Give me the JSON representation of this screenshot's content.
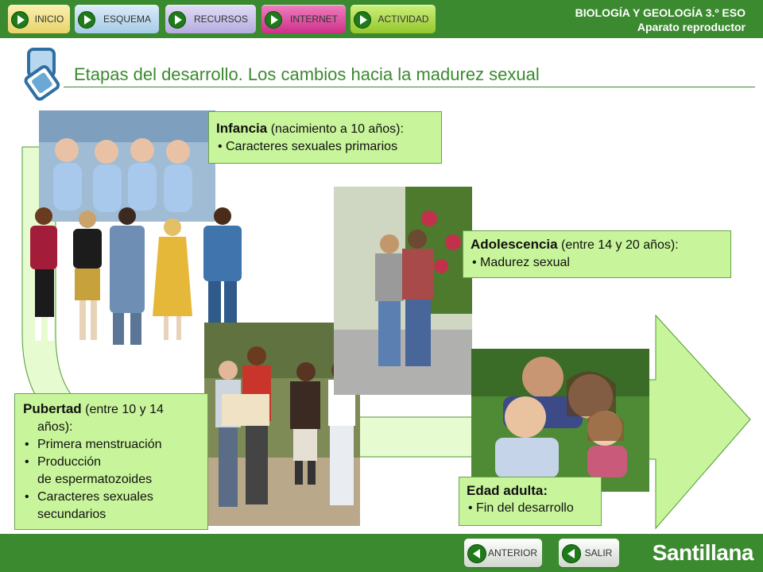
{
  "nav": {
    "items": [
      {
        "label": "INICIO"
      },
      {
        "label": "ESQUEMA"
      },
      {
        "label": "RECURSOS"
      },
      {
        "label": "INTERNET"
      },
      {
        "label": "ACTIVIDAD"
      }
    ]
  },
  "header": {
    "subject": "BIOLOGÍA Y GEOLOGÍA 3.º ESO",
    "unit": "Aparato reproductor"
  },
  "page": {
    "title": "Etapas del desarrollo. Los cambios hacia la madurez sexual"
  },
  "stages": {
    "infancia": {
      "name": "Infancia",
      "range": " (nacimiento a 10 años):",
      "items": [
        "Caracteres sexuales primarios"
      ]
    },
    "pubertad": {
      "name": "Pubertad",
      "range": " (entre 10 y 14",
      "range_cont": "años):",
      "items": [
        "Primera menstruación",
        "Producción",
        "de espermatozoides",
        "Caracteres sexuales",
        "secundarios"
      ]
    },
    "adolescencia": {
      "name": "Adolescencia",
      "range": " (entre 14 y 20 años):",
      "items": [
        "Madurez sexual"
      ]
    },
    "adulta": {
      "name": "Edad adulta:",
      "items": [
        "Fin del desarrollo"
      ]
    }
  },
  "footer": {
    "prev_label": "ANTERIOR",
    "exit_label": "SALIR",
    "logo": "Santillana"
  },
  "colors": {
    "bar_green": "#3b8a2f",
    "light_green": "#c8f59b",
    "nav_inicio": "#f3e189",
    "nav_esquema": "#b9d8ee",
    "nav_recursos": "#c9c3ea",
    "nav_internet": "#d9479a",
    "nav_actividad": "#a9d93c"
  }
}
